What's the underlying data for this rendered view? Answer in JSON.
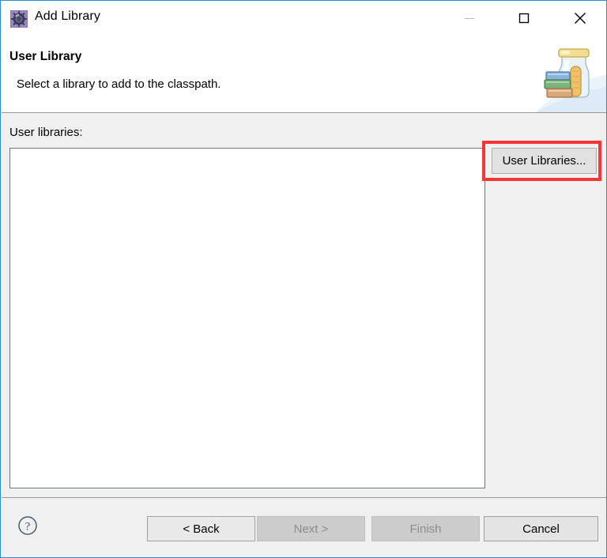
{
  "window": {
    "title": "Add Library",
    "title_icon": "eclipse-library-gear-icon",
    "controls": {
      "minimize": {
        "name": "minimize-button",
        "glyph": "minimize-icon",
        "enabled": false
      },
      "maximize": {
        "name": "maximize-button",
        "glyph": "maximize-icon",
        "enabled": true
      },
      "close": {
        "name": "close-button",
        "glyph": "close-icon",
        "enabled": true
      }
    }
  },
  "header": {
    "title": "User Library",
    "description": "Select a library to add to the classpath.",
    "banner_icon": "library-jar-books-icon"
  },
  "content": {
    "list_label": "User libraries:",
    "list_items": [],
    "side_buttons": [
      {
        "label": "User Libraries...",
        "name": "user-libraries-button",
        "enabled": true,
        "highlighted": true
      }
    ]
  },
  "annotation": {
    "type": "red-highlight-rectangle",
    "color": "#f73636",
    "target": "user-libraries-button"
  },
  "footer": {
    "help_icon": "help-question-icon",
    "buttons": [
      {
        "label": "< Back",
        "name": "back-button",
        "enabled": true
      },
      {
        "label": "Next >",
        "name": "next-button",
        "enabled": false
      },
      {
        "label": "Finish",
        "name": "finish-button",
        "enabled": false
      },
      {
        "label": "Cancel",
        "name": "cancel-button",
        "enabled": true
      }
    ]
  },
  "colors": {
    "window_border": "#2a8ad4",
    "content_bg": "#f0f0f0",
    "header_bg": "#ffffff",
    "list_bg": "#ffffff",
    "highlight": "#f73636"
  }
}
